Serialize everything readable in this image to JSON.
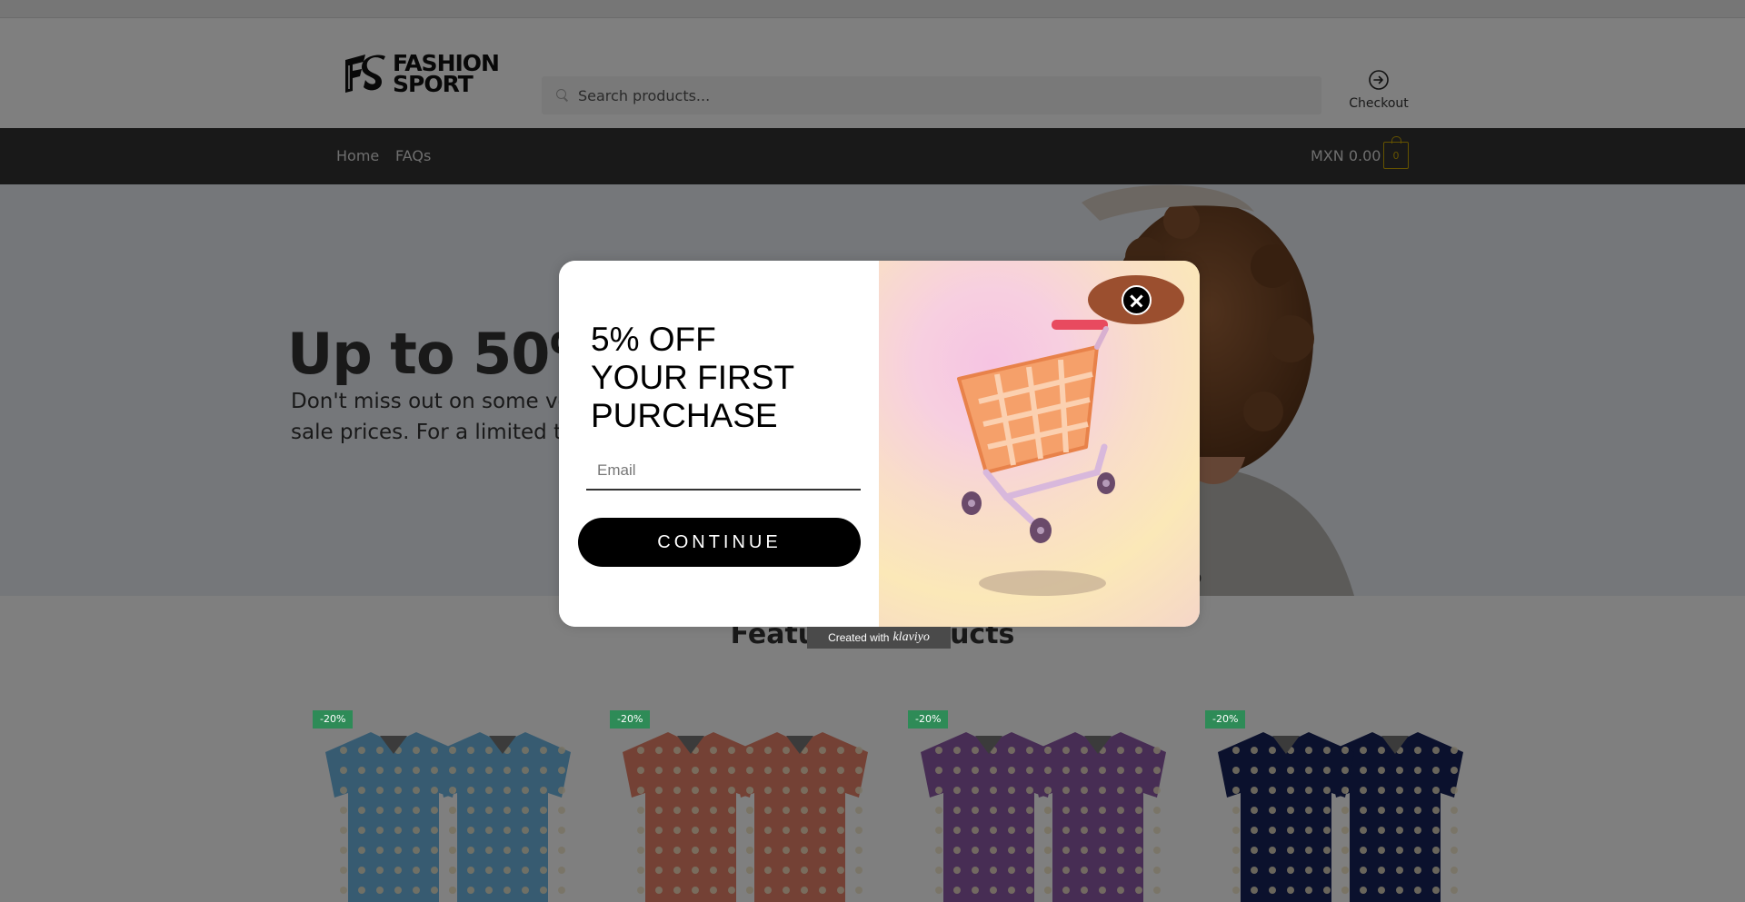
{
  "header": {
    "logo_text_line1": "FASHION",
    "logo_text_line2": "SPORT",
    "search_placeholder": "Search products...",
    "checkout_label": "Checkout"
  },
  "nav": {
    "items": [
      {
        "label": "Home"
      },
      {
        "label": "FAQs"
      }
    ],
    "cart_total": "MXN 0.00",
    "cart_count": "0"
  },
  "hero": {
    "title": "Up to 50%",
    "subtitle": "Don't miss out on some very sale prices. For a limited time"
  },
  "featured": {
    "title": "Featured Products"
  },
  "products": [
    {
      "badge": "-20%",
      "color": "#6fb6e3"
    },
    {
      "badge": "-20%",
      "color": "#e8836a"
    },
    {
      "badge": "-20%",
      "color": "#8e5aa8"
    },
    {
      "badge": "-20%",
      "color": "#16225a"
    }
  ],
  "popup": {
    "headline_line1": "5% OFF",
    "headline_line2": "YOUR FIRST",
    "headline_line3": "PURCHASE",
    "email_placeholder": "Email",
    "continue_label": "CONTINUE",
    "badge_prefix": "Created with",
    "badge_brand": "klaviyo"
  },
  "colors": {
    "accent_close": "#9b4f2f",
    "sale_badge": "#2e8b57",
    "cart_outline": "#c8a400"
  }
}
